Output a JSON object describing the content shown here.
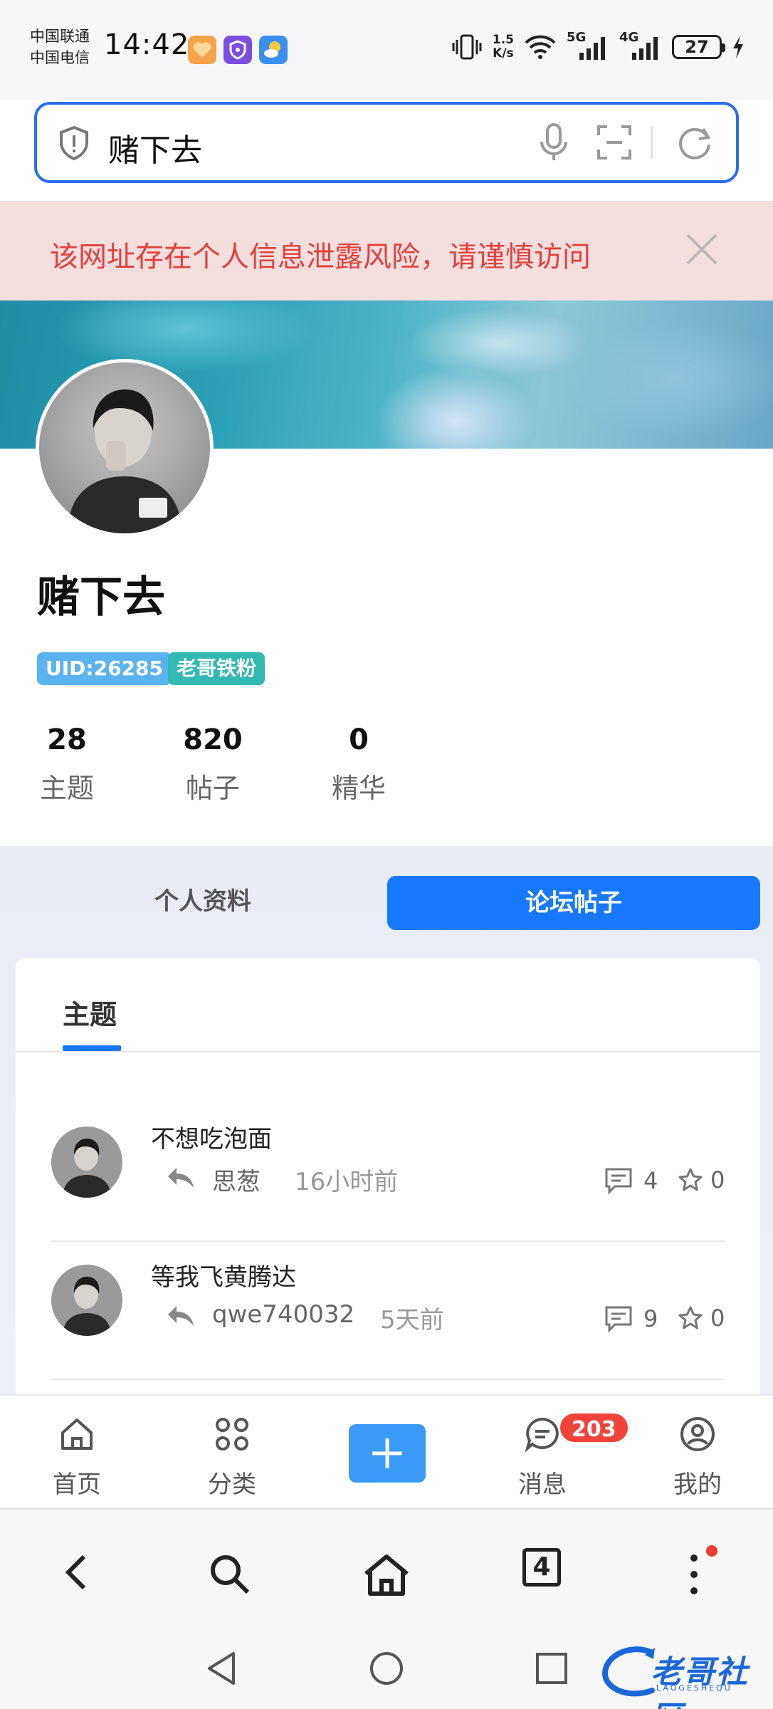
{
  "status_bar": {
    "carrier1": "中国联通",
    "carrier2": "中国电信",
    "time": "14:42",
    "net_speed_top": "1.5",
    "net_speed_bottom": "K/s",
    "signal1_label": "5G",
    "signal2_label": "4G",
    "battery": "27"
  },
  "search": {
    "query": "赌下去"
  },
  "warning": {
    "text": "该网址存在个人信息泄露风险，请谨慎访问"
  },
  "profile": {
    "username": "赌下去",
    "uid_tag": "UID:26285",
    "fan_tag": "老哥铁粉",
    "stats": [
      {
        "value": "28",
        "label": "主题"
      },
      {
        "value": "820",
        "label": "帖子"
      },
      {
        "value": "0",
        "label": "精华"
      }
    ]
  },
  "tabs": {
    "profile": "个人资料",
    "posts": "论坛帖子"
  },
  "card": {
    "tab": "主题"
  },
  "threads": [
    {
      "title": "不想吃泡面",
      "author": "思葱",
      "time": "16小时前",
      "comments": "4",
      "stars": "0"
    },
    {
      "title": "等我飞黄腾达",
      "author": "qwe740032",
      "time": "5天前",
      "comments": "9",
      "stars": "0"
    }
  ],
  "site_nav": {
    "items": [
      {
        "label": "首页"
      },
      {
        "label": "分类"
      },
      {
        "label": "消息"
      },
      {
        "label": "我的"
      }
    ],
    "message_badge": "203"
  },
  "browser": {
    "tab_count": "4"
  },
  "watermark": {
    "text": "老哥社区",
    "sub": "LAOGESHEQU"
  },
  "colors": {
    "accent": "#1677ff",
    "warning_text": "#e0413b",
    "warning_bg": "#f5dede",
    "badge": "#f0443b"
  }
}
